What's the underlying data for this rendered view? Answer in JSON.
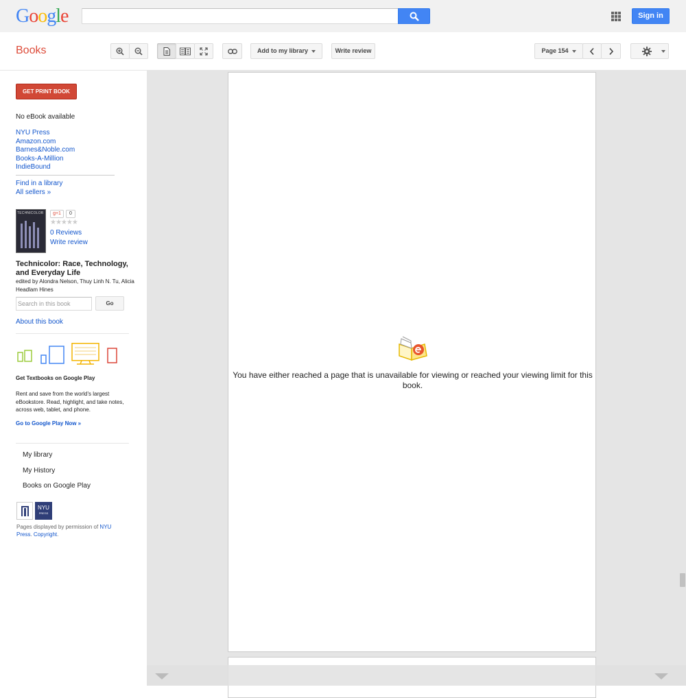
{
  "header": {
    "logo_letters": [
      {
        "ch": "G",
        "color": "#4285f4"
      },
      {
        "ch": "o",
        "color": "#ea4335"
      },
      {
        "ch": "o",
        "color": "#fbbc05"
      },
      {
        "ch": "g",
        "color": "#4285f4"
      },
      {
        "ch": "l",
        "color": "#34a853"
      },
      {
        "ch": "e",
        "color": "#ea4335"
      }
    ],
    "search_value": "",
    "signin_label": "Sign in"
  },
  "toolbar": {
    "section_title": "Books",
    "add_library_label": "Add to my library",
    "write_review_label": "Write review",
    "page_label": "Page 154"
  },
  "sidebar": {
    "get_print_label": "GET PRINT BOOK",
    "no_ebook": "No eBook available",
    "sellers": [
      "NYU Press",
      "Amazon.com",
      "Barnes&Noble.com",
      "Books-A-Million",
      "IndieBound"
    ],
    "find_library": "Find in a library",
    "all_sellers": "All sellers »",
    "cover_text": "TECHNICOLOR",
    "gplus_label": "g+1",
    "gplus_count": "0",
    "stars": "★★★★★",
    "reviews_label": "0 Reviews",
    "write_review": "Write review",
    "book_title": "Technicolor: Race, Technology, and Everyday Life",
    "book_authors": "edited by Alondra Nelson, Thuy Linh N. Tu, Alicia Headlam Hines",
    "search_placeholder": "Search in this book",
    "go_label": "Go",
    "about_book": "About this book",
    "promo_title": "Get Textbooks on Google Play",
    "promo_text": "Rent and save from the world's largest eBookstore. Read, highlight, and take notes, across web, tablet, and phone.",
    "promo_link": "Go to Google Play Now »",
    "nav": [
      "My library",
      "My History",
      "Books on Google Play"
    ],
    "press_logo_text": "NYU",
    "press_logo_sub": "PRESS",
    "permission_prefix": "Pages displayed by permission of",
    "permission_link": "NYU Press",
    "copyright_link": "Copyright"
  },
  "viewer": {
    "unavailable_message": "You have either reached a page that is unavailable for viewing or reached your viewing limit for this book."
  },
  "colors": {
    "brand_red": "#dd4b39",
    "button_blue": "#4285f4",
    "link_blue": "#1155cc"
  }
}
